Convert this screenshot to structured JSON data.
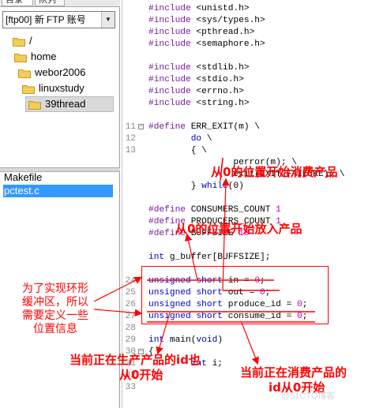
{
  "left_panel": {
    "tabs": [
      "目录",
      "队列"
    ],
    "server": "[ftp00] 新 FTP 账号",
    "folders": [
      {
        "name": "/"
      },
      {
        "name": "home"
      },
      {
        "name": "webor2006"
      },
      {
        "name": "linuxstudy"
      },
      {
        "name": "39thread",
        "selected": true
      }
    ],
    "files": [
      {
        "name": "Makefile",
        "selected": false
      },
      {
        "name": "pctest.c",
        "selected": true
      }
    ]
  },
  "code": {
    "lines": [
      {
        "n": "",
        "text": "#include <unistd.h>"
      },
      {
        "n": "",
        "text": "#include <sys/types.h>"
      },
      {
        "n": "",
        "text": "#include <pthread.h>"
      },
      {
        "n": "",
        "text": "#include <semaphore.h>"
      },
      {
        "n": "",
        "text": ""
      },
      {
        "n": "",
        "text": "#include <stdlib.h>"
      },
      {
        "n": "",
        "text": "#include <stdio.h>"
      },
      {
        "n": "",
        "text": "#include <errno.h>"
      },
      {
        "n": "",
        "text": "#include <string.h>"
      },
      {
        "n": "",
        "text": ""
      },
      {
        "n": "11",
        "fold": true,
        "text": "#define ERR_EXIT(m) \\"
      },
      {
        "n": "12",
        "text": "        do \\"
      },
      {
        "n": "13",
        "text": "        { \\"
      },
      {
        "n": "",
        "text": "                perror(m); \\"
      },
      {
        "n": "",
        "text": "                exit(EXIT_FAILURE); \\"
      },
      {
        "n": "",
        "text": "        } while(0)"
      },
      {
        "n": "",
        "text": ""
      },
      {
        "n": "",
        "text": "#define CONSUMERS_COUNT 1"
      },
      {
        "n": "",
        "text": "#define PRODUCERS_COUNT 1"
      },
      {
        "n": "",
        "text": "#define BUFFSIZE 10"
      },
      {
        "n": "",
        "text": ""
      },
      {
        "n": "",
        "text": "int g_buffer[BUFFSIZE];"
      },
      {
        "n": "",
        "text": ""
      },
      {
        "n": "24",
        "text": "unsigned short in = 0;"
      },
      {
        "n": "25",
        "text": "unsigned short out = 0;"
      },
      {
        "n": "26",
        "text": "unsigned short produce_id = 0;"
      },
      {
        "n": "27",
        "text": "unsigned short consume_id = 0;"
      },
      {
        "n": "28",
        "text": ""
      },
      {
        "n": "29",
        "text": "int main(void)"
      },
      {
        "n": "30",
        "fold": true,
        "text": "{"
      },
      {
        "n": "31",
        "text": "        int i;"
      },
      {
        "n": "32",
        "text": ""
      },
      {
        "n": "33",
        "text": ""
      }
    ]
  },
  "annotations": {
    "consume_pos": "从0的位置开始消费产品",
    "produce_pos": "从0的位置开始放入产品",
    "ring_buffer": "为了实现环形缓冲区，所以需要定义一些位置信息",
    "produce_id": "当前正在生产产品的id也从0开始",
    "produce_id_line1": "当前正在生产产品的id也",
    "produce_id_line2": "从0开始",
    "consume_id_line1": "当前正在消费产品的",
    "consume_id_line2": "id从0开始"
  },
  "watermark": "@51CTO博客",
  "colors": {
    "annotation": "#ff0000",
    "selection": "#3399ff",
    "keyword": "#0000c0",
    "preprocessor": "#7a1a9a",
    "number": "#c000c0"
  }
}
